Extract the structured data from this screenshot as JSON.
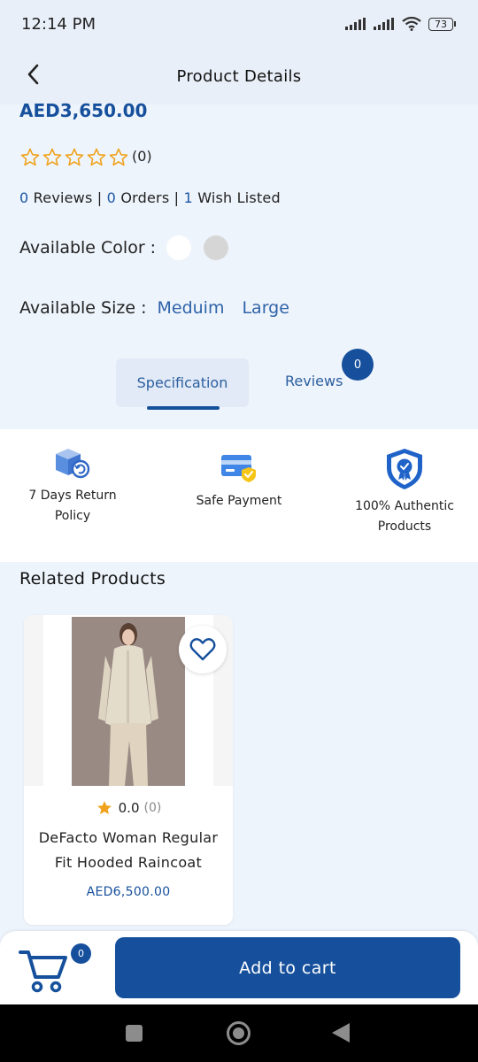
{
  "status_bar": {
    "time": "12:14 PM",
    "battery": "73"
  },
  "header": {
    "title": "Product Details"
  },
  "product": {
    "price": "AED3,650.00",
    "rating_count": "(0)",
    "stars_filled": 0,
    "stats": {
      "reviews_num": "0",
      "reviews_label": " Reviews | ",
      "orders_num": "0",
      "orders_label": " Orders | ",
      "wish_num": "1",
      "wish_label": " Wish Listed"
    },
    "color_label": "Available Color :",
    "colors": [
      "#ffffff",
      "#d6d6d6"
    ],
    "size_label": "Available Size :",
    "sizes": [
      "Meduim",
      "Large"
    ]
  },
  "tabs": {
    "spec": "Specification",
    "reviews": "Reviews",
    "reviews_badge": "0"
  },
  "features": {
    "return_line1": "7 Days Return",
    "return_line2": "Policy",
    "payment": "Safe Payment",
    "authentic_line1": "100% Authentic",
    "authentic_line2": "Products"
  },
  "related": {
    "title": "Related Products",
    "items": [
      {
        "rating": "0.0",
        "count": "(0)",
        "name_line1": "DeFacto Woman Regular",
        "name_line2": "Fit Hooded Raincoat",
        "price": "AED6,500.00"
      }
    ]
  },
  "bottom": {
    "cart_badge": "0",
    "add_to_cart": "Add to cart"
  },
  "colors": {
    "primary": "#16509c",
    "accent_star": "#f0a21c",
    "background": "#eef4fc"
  }
}
